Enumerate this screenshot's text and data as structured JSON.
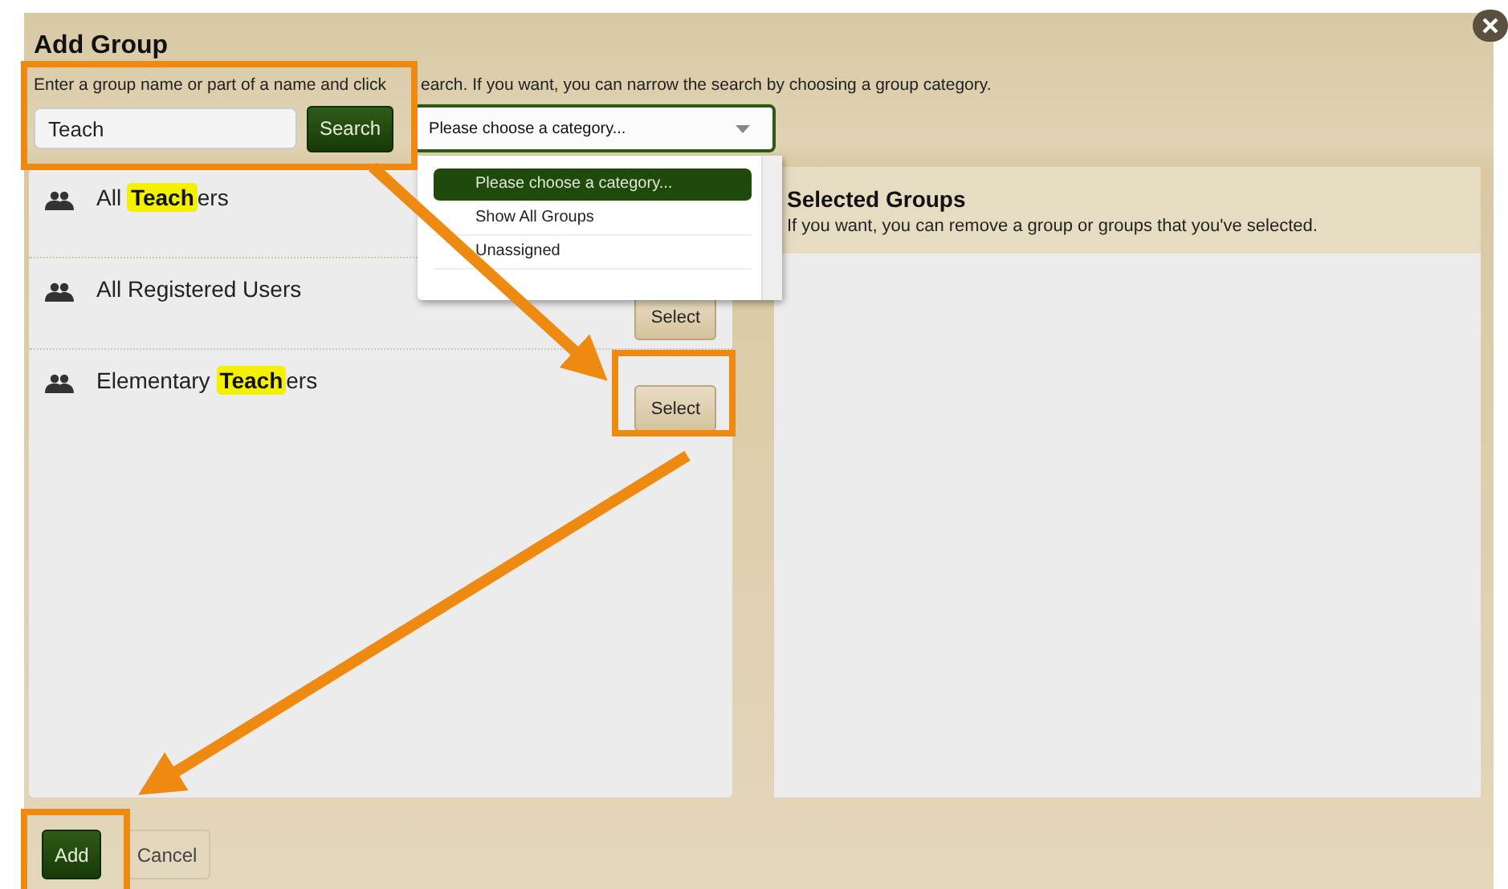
{
  "dialog": {
    "title": "Add Group",
    "instructions": "Enter a group name or part of a name and click",
    "instructions_rest": "earch. If you want, you can narrow the search by choosing a group category."
  },
  "search": {
    "value": "Teach",
    "button": "Search"
  },
  "category": {
    "value": "Please choose a category...",
    "expanded": true,
    "options": [
      {
        "label": "Please choose a category...",
        "selected": true
      },
      {
        "label": "Show All Groups",
        "selected": false
      },
      {
        "label": "Unassigned",
        "selected": false
      }
    ]
  },
  "results": [
    {
      "parts": [
        {
          "text": "All ",
          "highlight": false
        },
        {
          "text": "Teach",
          "highlight": true
        },
        {
          "text": "ers",
          "highlight": false
        }
      ]
    },
    {
      "parts": [
        {
          "text": "All Registered Users",
          "highlight": false
        }
      ],
      "button": "Select"
    },
    {
      "parts": [
        {
          "text": "Elementary ",
          "highlight": false
        },
        {
          "text": "Teach",
          "highlight": true
        },
        {
          "text": "ers",
          "highlight": false
        }
      ],
      "button": "Select"
    }
  ],
  "selected_panel": {
    "title": "Selected Groups",
    "hint": "If you want, you can remove a group or groups that you've selected."
  },
  "buttons": [
    {
      "label": "Add",
      "kind": "primary"
    },
    {
      "label": "Cancel",
      "kind": "secondary"
    }
  ]
}
